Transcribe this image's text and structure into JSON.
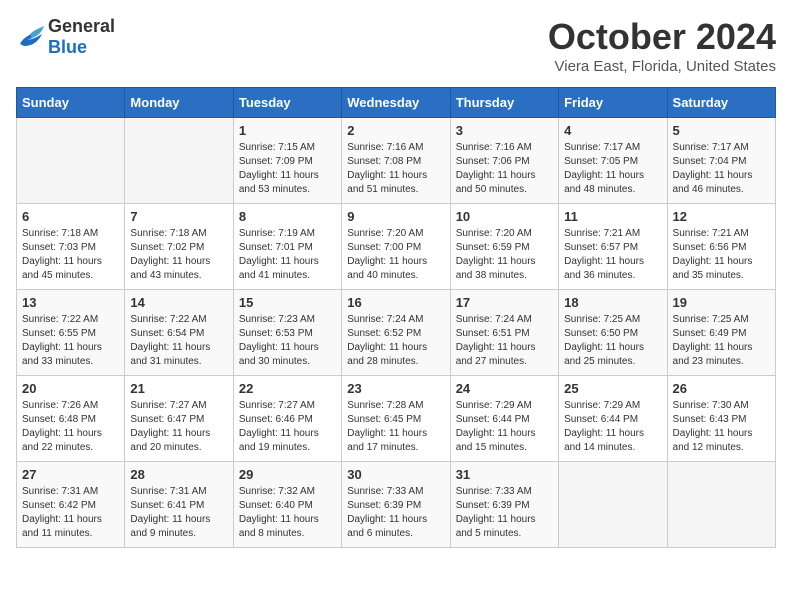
{
  "logo": {
    "general": "General",
    "blue": "Blue"
  },
  "title": "October 2024",
  "location": "Viera East, Florida, United States",
  "days_of_week": [
    "Sunday",
    "Monday",
    "Tuesday",
    "Wednesday",
    "Thursday",
    "Friday",
    "Saturday"
  ],
  "weeks": [
    [
      {
        "day": "",
        "empty": true
      },
      {
        "day": "",
        "empty": true
      },
      {
        "day": "1",
        "sunrise": "Sunrise: 7:15 AM",
        "sunset": "Sunset: 7:09 PM",
        "daylight": "Daylight: 11 hours and 53 minutes."
      },
      {
        "day": "2",
        "sunrise": "Sunrise: 7:16 AM",
        "sunset": "Sunset: 7:08 PM",
        "daylight": "Daylight: 11 hours and 51 minutes."
      },
      {
        "day": "3",
        "sunrise": "Sunrise: 7:16 AM",
        "sunset": "Sunset: 7:06 PM",
        "daylight": "Daylight: 11 hours and 50 minutes."
      },
      {
        "day": "4",
        "sunrise": "Sunrise: 7:17 AM",
        "sunset": "Sunset: 7:05 PM",
        "daylight": "Daylight: 11 hours and 48 minutes."
      },
      {
        "day": "5",
        "sunrise": "Sunrise: 7:17 AM",
        "sunset": "Sunset: 7:04 PM",
        "daylight": "Daylight: 11 hours and 46 minutes."
      }
    ],
    [
      {
        "day": "6",
        "sunrise": "Sunrise: 7:18 AM",
        "sunset": "Sunset: 7:03 PM",
        "daylight": "Daylight: 11 hours and 45 minutes."
      },
      {
        "day": "7",
        "sunrise": "Sunrise: 7:18 AM",
        "sunset": "Sunset: 7:02 PM",
        "daylight": "Daylight: 11 hours and 43 minutes."
      },
      {
        "day": "8",
        "sunrise": "Sunrise: 7:19 AM",
        "sunset": "Sunset: 7:01 PM",
        "daylight": "Daylight: 11 hours and 41 minutes."
      },
      {
        "day": "9",
        "sunrise": "Sunrise: 7:20 AM",
        "sunset": "Sunset: 7:00 PM",
        "daylight": "Daylight: 11 hours and 40 minutes."
      },
      {
        "day": "10",
        "sunrise": "Sunrise: 7:20 AM",
        "sunset": "Sunset: 6:59 PM",
        "daylight": "Daylight: 11 hours and 38 minutes."
      },
      {
        "day": "11",
        "sunrise": "Sunrise: 7:21 AM",
        "sunset": "Sunset: 6:57 PM",
        "daylight": "Daylight: 11 hours and 36 minutes."
      },
      {
        "day": "12",
        "sunrise": "Sunrise: 7:21 AM",
        "sunset": "Sunset: 6:56 PM",
        "daylight": "Daylight: 11 hours and 35 minutes."
      }
    ],
    [
      {
        "day": "13",
        "sunrise": "Sunrise: 7:22 AM",
        "sunset": "Sunset: 6:55 PM",
        "daylight": "Daylight: 11 hours and 33 minutes."
      },
      {
        "day": "14",
        "sunrise": "Sunrise: 7:22 AM",
        "sunset": "Sunset: 6:54 PM",
        "daylight": "Daylight: 11 hours and 31 minutes."
      },
      {
        "day": "15",
        "sunrise": "Sunrise: 7:23 AM",
        "sunset": "Sunset: 6:53 PM",
        "daylight": "Daylight: 11 hours and 30 minutes."
      },
      {
        "day": "16",
        "sunrise": "Sunrise: 7:24 AM",
        "sunset": "Sunset: 6:52 PM",
        "daylight": "Daylight: 11 hours and 28 minutes."
      },
      {
        "day": "17",
        "sunrise": "Sunrise: 7:24 AM",
        "sunset": "Sunset: 6:51 PM",
        "daylight": "Daylight: 11 hours and 27 minutes."
      },
      {
        "day": "18",
        "sunrise": "Sunrise: 7:25 AM",
        "sunset": "Sunset: 6:50 PM",
        "daylight": "Daylight: 11 hours and 25 minutes."
      },
      {
        "day": "19",
        "sunrise": "Sunrise: 7:25 AM",
        "sunset": "Sunset: 6:49 PM",
        "daylight": "Daylight: 11 hours and 23 minutes."
      }
    ],
    [
      {
        "day": "20",
        "sunrise": "Sunrise: 7:26 AM",
        "sunset": "Sunset: 6:48 PM",
        "daylight": "Daylight: 11 hours and 22 minutes."
      },
      {
        "day": "21",
        "sunrise": "Sunrise: 7:27 AM",
        "sunset": "Sunset: 6:47 PM",
        "daylight": "Daylight: 11 hours and 20 minutes."
      },
      {
        "day": "22",
        "sunrise": "Sunrise: 7:27 AM",
        "sunset": "Sunset: 6:46 PM",
        "daylight": "Daylight: 11 hours and 19 minutes."
      },
      {
        "day": "23",
        "sunrise": "Sunrise: 7:28 AM",
        "sunset": "Sunset: 6:45 PM",
        "daylight": "Daylight: 11 hours and 17 minutes."
      },
      {
        "day": "24",
        "sunrise": "Sunrise: 7:29 AM",
        "sunset": "Sunset: 6:44 PM",
        "daylight": "Daylight: 11 hours and 15 minutes."
      },
      {
        "day": "25",
        "sunrise": "Sunrise: 7:29 AM",
        "sunset": "Sunset: 6:44 PM",
        "daylight": "Daylight: 11 hours and 14 minutes."
      },
      {
        "day": "26",
        "sunrise": "Sunrise: 7:30 AM",
        "sunset": "Sunset: 6:43 PM",
        "daylight": "Daylight: 11 hours and 12 minutes."
      }
    ],
    [
      {
        "day": "27",
        "sunrise": "Sunrise: 7:31 AM",
        "sunset": "Sunset: 6:42 PM",
        "daylight": "Daylight: 11 hours and 11 minutes."
      },
      {
        "day": "28",
        "sunrise": "Sunrise: 7:31 AM",
        "sunset": "Sunset: 6:41 PM",
        "daylight": "Daylight: 11 hours and 9 minutes."
      },
      {
        "day": "29",
        "sunrise": "Sunrise: 7:32 AM",
        "sunset": "Sunset: 6:40 PM",
        "daylight": "Daylight: 11 hours and 8 minutes."
      },
      {
        "day": "30",
        "sunrise": "Sunrise: 7:33 AM",
        "sunset": "Sunset: 6:39 PM",
        "daylight": "Daylight: 11 hours and 6 minutes."
      },
      {
        "day": "31",
        "sunrise": "Sunrise: 7:33 AM",
        "sunset": "Sunset: 6:39 PM",
        "daylight": "Daylight: 11 hours and 5 minutes."
      },
      {
        "day": "",
        "empty": true
      },
      {
        "day": "",
        "empty": true
      }
    ]
  ]
}
